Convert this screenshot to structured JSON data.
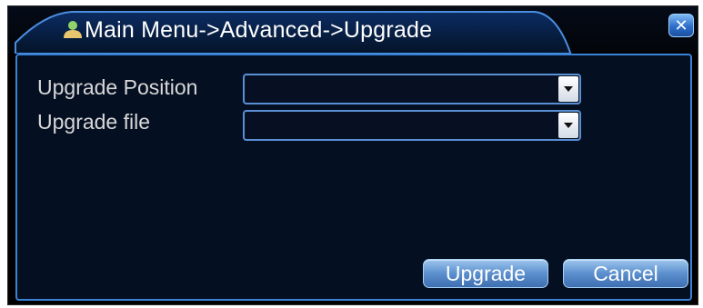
{
  "window": {
    "title": "Main Menu->Advanced->Upgrade",
    "title_icon": "person-icon",
    "close_icon": "close-icon",
    "close_glyph": "✕"
  },
  "form": {
    "upgrade_position": {
      "label": "Upgrade Position",
      "value": ""
    },
    "upgrade_file": {
      "label": "Upgrade file",
      "value": ""
    }
  },
  "buttons": {
    "upgrade": "Upgrade",
    "cancel": "Cancel"
  },
  "colors": {
    "panel_border": "#3a82d8",
    "button_blue": "#5c8fce",
    "background": "#050f22"
  }
}
